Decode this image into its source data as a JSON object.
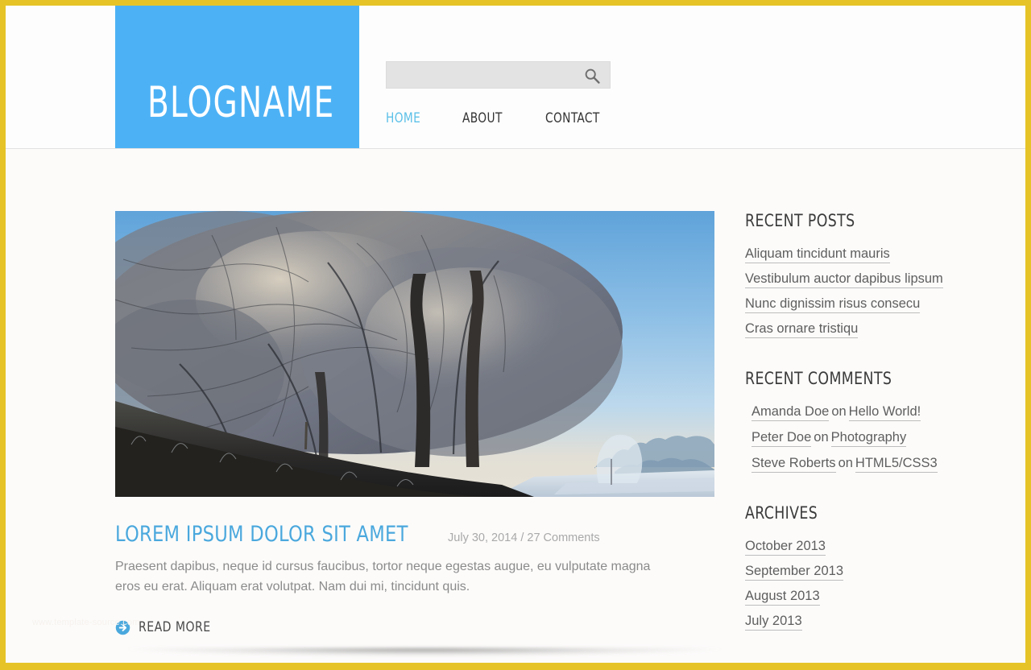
{
  "theme": {
    "frame_color": "#e6c428",
    "accent_color": "#4db2f5",
    "nav_active_color": "#5bc0e8",
    "title_color": "#4aa8dd",
    "page_background": "#fcfbfa",
    "search_background": "#e3e3e3"
  },
  "header": {
    "logo_text": "BLOGNAME",
    "search": {
      "value": "",
      "placeholder": "",
      "icon": "search-icon"
    },
    "nav": [
      {
        "label": "HOME",
        "active": true
      },
      {
        "label": "ABOUT",
        "active": false
      },
      {
        "label": "CONTACT",
        "active": false
      }
    ]
  },
  "post": {
    "image_alt": "frost-covered-trees-winter-landscape",
    "title": "LOREM IPSUM DOLOR SIT AMET",
    "meta": "July 30, 2014 / 27 Comments",
    "date": "July 30, 2014",
    "comment_count": "27 Comments",
    "body": "Praesent dapibus, neque id cursus faucibus, tortor neque egestas augue, eu vulputate magna eros eu erat. Aliquam erat volutpat. Nam dui mi, tincidunt quis.",
    "read_more_label": "READ MORE",
    "read_more_icon": "arrow-right-circle-icon"
  },
  "sidebar": {
    "recent_posts": {
      "title": "RECENT POSTS",
      "items": [
        "Aliquam tincidunt mauris",
        "Vestibulum auctor dapibus lipsum",
        "Nunc dignissim risus consecu",
        "Cras ornare tristiqu"
      ]
    },
    "recent_comments": {
      "title": "RECENT COMMENTS",
      "separator": "on",
      "items": [
        {
          "author": "Amanda Doe",
          "post": "Hello World!"
        },
        {
          "author": "Peter Doe",
          "post": "Photography"
        },
        {
          "author": "Steve Roberts",
          "post": "HTML5/CSS3"
        }
      ]
    },
    "archives": {
      "title": "ARCHIVES",
      "items": [
        "October 2013",
        "September 2013",
        "August 2013",
        "July 2013"
      ]
    }
  },
  "watermark": "www.template-source.com"
}
